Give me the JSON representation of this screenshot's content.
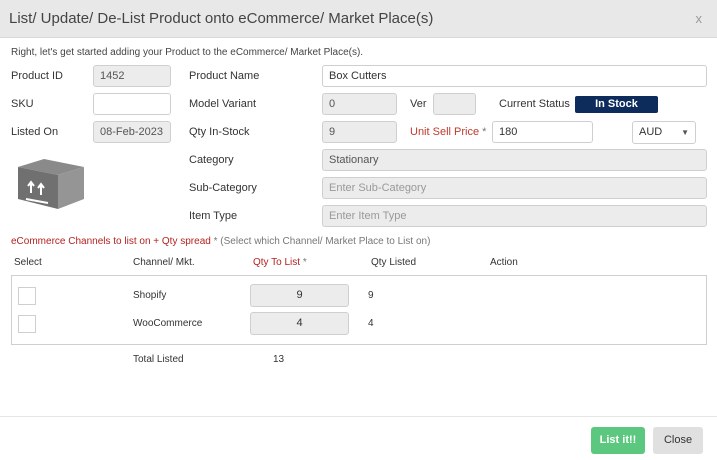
{
  "dialog": {
    "title": "List/ Update/ De-List Product onto eCommerce/ Market Place(s)",
    "close_glyph": "x",
    "intro": "Right, let's get started adding your Product to the eCommerce/ Market Place(s)."
  },
  "form": {
    "product_id": {
      "label": "Product ID",
      "value": "1452"
    },
    "sku": {
      "label": "SKU",
      "value": ""
    },
    "listed_on": {
      "label": "Listed On",
      "value": "08-Feb-2023"
    },
    "product_name": {
      "label": "Product Name",
      "value": "Box Cutters"
    },
    "model_variant": {
      "label": "Model Variant",
      "value": "0"
    },
    "ver": {
      "label": "Ver",
      "value": ""
    },
    "current_status": {
      "label": "Current Status",
      "value": "In Stock",
      "color": "#0d2c5c"
    },
    "qty_in_stock": {
      "label": "Qty In-Stock",
      "value": "9"
    },
    "unit_sell_price": {
      "label": "Unit Sell Price",
      "required": "*",
      "value": "180"
    },
    "currency": {
      "value": "AUD"
    },
    "category": {
      "label": "Category",
      "value": "Stationary"
    },
    "sub_category": {
      "label": "Sub-Category",
      "placeholder": "Enter Sub-Category"
    },
    "item_type": {
      "label": "Item Type",
      "placeholder": "Enter Item Type"
    }
  },
  "channels": {
    "section_label": "eCommerce Channels to list on + Qty spread",
    "required": "*",
    "hint": "(Select which Channel/ Market Place to List on)",
    "headers": {
      "select": "Select",
      "channel": "Channel/ Mkt.",
      "qty_to_list": "Qty To List",
      "qty_to_list_required": "*",
      "qty_listed": "Qty Listed",
      "action": "Action"
    },
    "rows": [
      {
        "channel": "Shopify",
        "qty_to_list": "9",
        "qty_listed": "9"
      },
      {
        "channel": "WooCommerce",
        "qty_to_list": "4",
        "qty_listed": "4"
      }
    ],
    "total_label": "Total Listed",
    "total_value": "13"
  },
  "footer": {
    "list_button": "List it!!",
    "close_button": "Close"
  },
  "colors": {
    "accent_red": "#b22222",
    "status_navy": "#0d2c5c",
    "list_button_green": "#5cc77f"
  },
  "icons": {
    "product": "box-package-icon"
  }
}
